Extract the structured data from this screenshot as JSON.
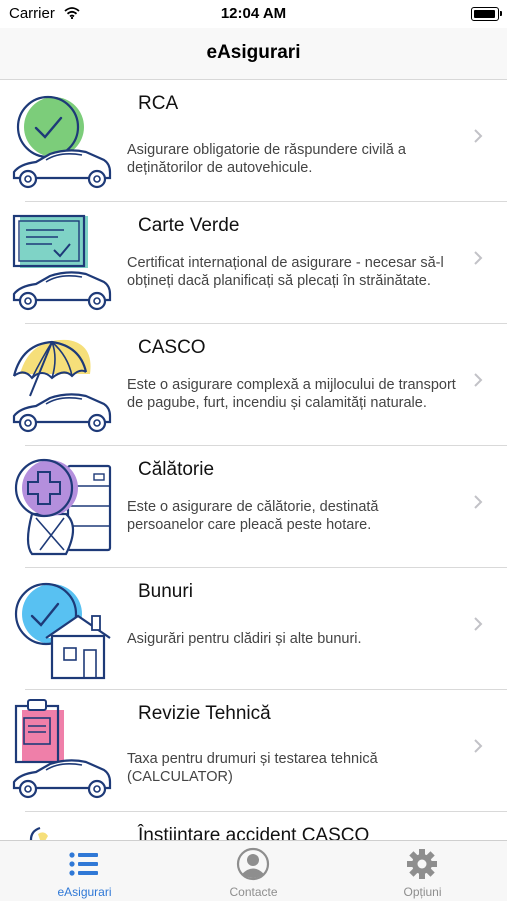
{
  "status_bar": {
    "carrier": "Carrier",
    "time": "12:04 AM",
    "wifi_icon": "wifi-icon",
    "battery_icon": "battery-icon"
  },
  "nav": {
    "title": "eAsigurari"
  },
  "items": [
    {
      "title": "RCA",
      "description": "Asigurare obligatorie de răspundere civilă a deținătorilor de autovehicule.",
      "icon": "rca-check-car-icon"
    },
    {
      "title": "Carte Verde",
      "description": "Certificat internațional de asigurare - necesar să-l obțineți dacă planificați să plecați în străinătate.",
      "icon": "certificate-car-icon"
    },
    {
      "title": "CASCO",
      "description": "Este o asigurare complexă a mijlocului de transport de pagube, furt, incendiu și calamități naturale.",
      "icon": "umbrella-car-icon"
    },
    {
      "title": "Călătorie",
      "description": "Este o asigurare de călătorie, destinată persoanelor care pleacă peste hotare.",
      "icon": "medical-luggage-icon"
    },
    {
      "title": "Bunuri",
      "description": "Asigurări pentru clădiri și alte bunuri.",
      "icon": "house-check-icon"
    },
    {
      "title": "Revizie Tehnică",
      "description": "Taxa pentru drumuri și testarea tehnică (CALCULATOR)",
      "icon": "clipboard-car-icon"
    },
    {
      "title": "Înștiințare accident CASCO",
      "description": "",
      "icon": "accident-icon"
    }
  ],
  "tabs": [
    {
      "label": "eAsigurari",
      "icon": "list-icon",
      "active": true
    },
    {
      "label": "Contacte",
      "icon": "contact-icon",
      "active": false
    },
    {
      "label": "Opțiuni",
      "icon": "gear-icon",
      "active": false
    }
  ],
  "colors": {
    "accent": "#2f78d6",
    "icon_stroke": "#1e3a78",
    "check_green": "#7ccd7a",
    "check_blue": "#58c1f2",
    "umbrella_yellow": "#f6df7a",
    "plus_purple": "#b48fdd",
    "clipboard_pink": "#ef7fa9"
  }
}
